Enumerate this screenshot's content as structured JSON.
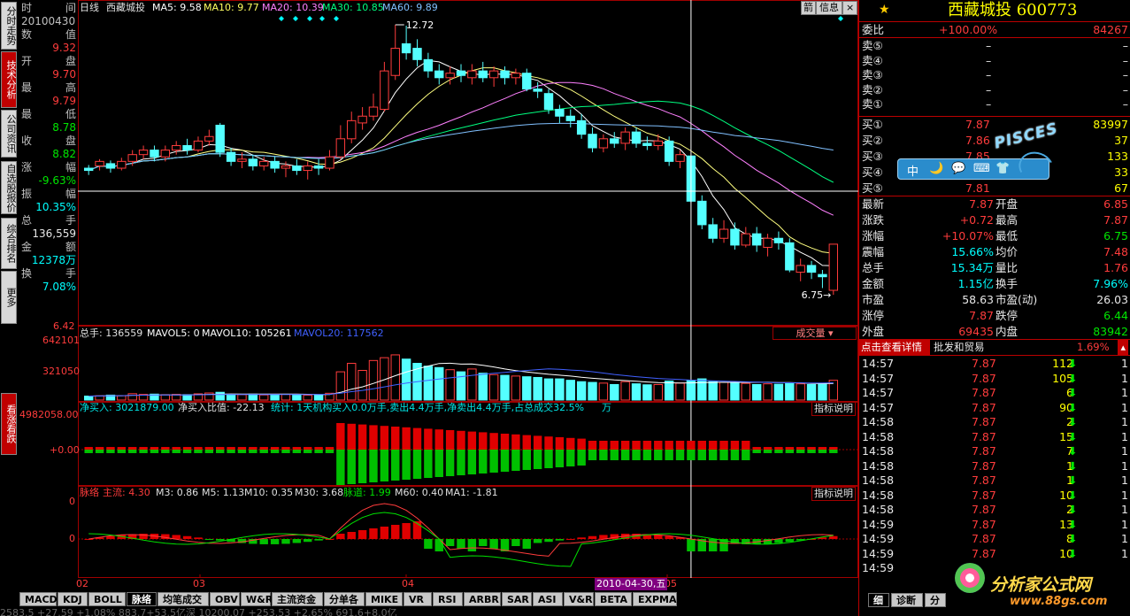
{
  "left_nav": [
    "分时走势",
    "技术分析",
    "公司资讯",
    "自选股报价",
    "综合排名",
    "更多"
  ],
  "left_nav_active": 1,
  "left_nav_lower": "看涨看跌",
  "info": [
    {
      "k": "时",
      "v": "间"
    },
    {
      "k": "20100430",
      "v": ""
    },
    {
      "k": "数",
      "v": "值"
    },
    {
      "k": "",
      "v": "9.32",
      "c": "red"
    },
    {
      "k": "开",
      "v": "盘"
    },
    {
      "k": "",
      "v": "9.70",
      "c": "red"
    },
    {
      "k": "最",
      "v": "高"
    },
    {
      "k": "",
      "v": "9.79",
      "c": "red"
    },
    {
      "k": "最",
      "v": "低"
    },
    {
      "k": "",
      "v": "8.78",
      "c": "grn"
    },
    {
      "k": "收",
      "v": "盘"
    },
    {
      "k": "",
      "v": "8.82",
      "c": "grn"
    },
    {
      "k": "涨",
      "v": "幅"
    },
    {
      "k": "",
      "v": "-9.63%",
      "c": "grn"
    },
    {
      "k": "振",
      "v": "幅"
    },
    {
      "k": "",
      "v": "10.35%",
      "c": "cyn"
    },
    {
      "k": "总",
      "v": "手"
    },
    {
      "k": "",
      "v": "136,559",
      "c": "wht"
    },
    {
      "k": "金",
      "v": "额"
    },
    {
      "k": "",
      "v": "12378万",
      "c": "cyn"
    },
    {
      "k": "换",
      "v": "手"
    },
    {
      "k": "",
      "v": "7.08%",
      "c": "cyn"
    }
  ],
  "main_header": {
    "period": "日线",
    "name": "西藏城投",
    "ma5": "MA5: 9.58",
    "ma10": "MA10: 9.77",
    "ma20": "MA20: 10.39",
    "ma30": "MA30: 10.85",
    "ma60": "MA60: 9.89"
  },
  "main_top_buttons": [
    "箭",
    "信息"
  ],
  "price_high_label": "12.72",
  "price_low_label": "6.75",
  "y_min_label": "6.42",
  "vol_header": {
    "t": "总手: 136559",
    "a": "MAVOL5: 0",
    "b": "MAVOL10: 105261",
    "c": "MAVOL20: 117562"
  },
  "vol_selector": "成交量",
  "vol_y": [
    "642101",
    "321050"
  ],
  "flow_header": {
    "a": "净买入: 3021879.00",
    "b": "净买入比值: -22.13",
    "c": "统计: 1天机构买入0.0万手,卖出4.4万手,净卖出4.4万手,占总成交32.5%",
    "d": "万"
  },
  "flow_y": [
    "4982058.00",
    "+0.00"
  ],
  "pulse_header": {
    "a": "脉络",
    "b": "主流: 4.30",
    "c": "M3: 0.86",
    "d": "M5: 1.13",
    "e": "M10: 0.35",
    "f": "M30: 3.68",
    "g": "脉道: 1.99",
    "h": "M60: 0.40",
    "i": "MA1: -1.81"
  },
  "pulse_y": [
    "0",
    "0"
  ],
  "indicator_btn": "指标说明",
  "x_axis": [
    "02",
    "03",
    "04",
    "05"
  ],
  "cursor_date": "2010-04-30,五",
  "bottom_tabs": [
    "MACD",
    "KDJ",
    "BOLL",
    "脉络",
    "均笔成交",
    "OBV",
    "W&R",
    "主流资金",
    "分单各",
    "MIKE",
    "VR",
    "RSI",
    "ARBR",
    "SAR",
    "ASI",
    "V&R",
    "BETA",
    "EXPMA"
  ],
  "bottom_active": 3,
  "status_partial": "2583.5 +27.59 +1.08%    883.7+53.5亿深  10200.07 +253.53 +2.65%  691.6+8.0亿",
  "right": {
    "title": "西藏城投 600773",
    "webi": {
      "k": "委比",
      "v": "+100.00%",
      "n": "84267"
    },
    "sells": [
      {
        "k": "卖⑤",
        "p": "–",
        "v": ""
      },
      {
        "k": "卖④",
        "p": "–",
        "v": ""
      },
      {
        "k": "卖③",
        "p": "–",
        "v": ""
      },
      {
        "k": "卖②",
        "p": "–",
        "v": ""
      },
      {
        "k": "卖①",
        "p": "–",
        "v": ""
      }
    ],
    "buys": [
      {
        "k": "买①",
        "p": "7.87",
        "v": "83997"
      },
      {
        "k": "买②",
        "p": "7.86",
        "v": "37"
      },
      {
        "k": "买③",
        "p": "7.85",
        "v": "133"
      },
      {
        "k": "买④",
        "p": "7.83",
        "v": "33"
      },
      {
        "k": "买⑤",
        "p": "7.81",
        "v": "67"
      }
    ],
    "stats": [
      {
        "a": "最新",
        "av": "7.87",
        "b": "开盘",
        "bv": "6.85",
        "ac": "red",
        "bc": "red"
      },
      {
        "a": "涨跌",
        "av": "+0.72",
        "b": "最高",
        "bv": "7.87",
        "ac": "red",
        "bc": "red"
      },
      {
        "a": "涨幅",
        "av": "+10.07%",
        "b": "最低",
        "bv": "6.75",
        "ac": "red",
        "bc": "grn"
      },
      {
        "a": "震幅",
        "av": "15.66%",
        "b": "均价",
        "bv": "7.48",
        "ac": "cyn",
        "bc": "red"
      },
      {
        "a": "总手",
        "av": "15.34万",
        "b": "量比",
        "bv": "1.76",
        "ac": "cyn",
        "bc": "red"
      },
      {
        "a": "金额",
        "av": "1.15亿",
        "b": "换手",
        "bv": "7.96%",
        "ac": "cyn",
        "bc": "cyn"
      },
      {
        "a": "市盈",
        "av": "58.63",
        "b": "市盈(动)",
        "bv": "26.03",
        "ac": "wht",
        "bc": "wht"
      },
      {
        "a": "涨停",
        "av": "7.87",
        "b": "跌停",
        "bv": "6.44",
        "ac": "red",
        "bc": "grn"
      },
      {
        "a": "外盘",
        "av": "69435",
        "b": "内盘",
        "bv": "83942",
        "ac": "red",
        "bc": "grn"
      }
    ],
    "detail_tab": "点击查看详情",
    "sector": "批发和贸易",
    "sector_pct": "1.69%",
    "ticks": [
      {
        "t": "14:57",
        "p": "7.87",
        "v": "112",
        "n": "1"
      },
      {
        "t": "14:57",
        "p": "7.87",
        "v": "105",
        "n": "1"
      },
      {
        "t": "14:57",
        "p": "7.87",
        "v": "6",
        "n": "1"
      },
      {
        "t": "14:57",
        "p": "7.87",
        "v": "90",
        "n": "1"
      },
      {
        "t": "14:58",
        "p": "7.87",
        "v": "2",
        "n": "1"
      },
      {
        "t": "14:58",
        "p": "7.87",
        "v": "15",
        "n": "1"
      },
      {
        "t": "14:58",
        "p": "7.87",
        "v": "7",
        "n": "1"
      },
      {
        "t": "14:58",
        "p": "7.87",
        "v": "1",
        "n": "1"
      },
      {
        "t": "14:58",
        "p": "7.87",
        "v": "1",
        "n": "1"
      },
      {
        "t": "14:58",
        "p": "7.87",
        "v": "10",
        "n": "1"
      },
      {
        "t": "14:58",
        "p": "7.87",
        "v": "2",
        "n": "1"
      },
      {
        "t": "14:59",
        "p": "7.87",
        "v": "13",
        "n": "1"
      },
      {
        "t": "14:59",
        "p": "7.87",
        "v": "8",
        "n": "1"
      },
      {
        "t": "14:59",
        "p": "7.87",
        "v": "10",
        "n": "1"
      },
      {
        "t": "14:59",
        "p": "",
        "v": "",
        "n": ""
      }
    ],
    "bottom_tabs": [
      "细",
      "诊断",
      "分"
    ],
    "watermark": "分析家公式网",
    "watermark_url": "www.88gs.com",
    "toolbar_icons": [
      "中",
      "🌙",
      "💬",
      "⌨",
      "👕"
    ],
    "pisces": "PISCES"
  },
  "chart_data": {
    "type": "candlestick",
    "candles": [
      [
        9.55,
        9.5,
        9.62,
        9.4
      ],
      [
        9.6,
        9.7,
        9.75,
        9.5
      ],
      [
        9.65,
        9.55,
        9.72,
        9.45
      ],
      [
        9.55,
        9.7,
        9.78,
        9.5
      ],
      [
        9.7,
        9.85,
        9.95,
        9.6
      ],
      [
        9.85,
        9.95,
        10.05,
        9.75
      ],
      [
        9.95,
        9.8,
        10.05,
        9.7
      ],
      [
        9.8,
        9.95,
        10.05,
        9.7
      ],
      [
        9.95,
        10.05,
        10.15,
        9.85
      ],
      [
        10.05,
        9.95,
        10.2,
        9.85
      ],
      [
        9.95,
        10.15,
        10.25,
        9.9
      ],
      [
        10.15,
        10.25,
        10.4,
        10.05
      ],
      [
        10.5,
        9.9,
        10.55,
        9.8
      ],
      [
        9.9,
        9.7,
        10.0,
        9.6
      ],
      [
        9.7,
        9.75,
        9.9,
        9.55
      ],
      [
        9.75,
        9.6,
        9.85,
        9.5
      ],
      [
        9.6,
        9.7,
        9.8,
        9.5
      ],
      [
        9.7,
        9.55,
        9.8,
        9.45
      ],
      [
        9.55,
        9.6,
        9.7,
        9.35
      ],
      [
        9.6,
        9.5,
        9.75,
        9.4
      ],
      [
        9.5,
        9.6,
        9.7,
        9.3
      ],
      [
        9.6,
        9.55,
        9.75,
        9.4
      ],
      [
        9.55,
        9.8,
        9.95,
        9.5
      ],
      [
        9.8,
        10.2,
        10.5,
        9.75
      ],
      [
        10.2,
        10.6,
        10.8,
        10.1
      ],
      [
        10.55,
        10.7,
        10.9,
        10.4
      ],
      [
        10.7,
        10.9,
        11.2,
        10.6
      ],
      [
        10.85,
        11.7,
        11.9,
        10.8
      ],
      [
        11.6,
        12.2,
        12.72,
        11.5
      ],
      [
        12.3,
        12.1,
        12.7,
        11.95
      ],
      [
        12.2,
        11.95,
        12.4,
        11.8
      ],
      [
        11.95,
        11.7,
        12.1,
        11.55
      ],
      [
        11.7,
        11.55,
        11.85,
        11.4
      ],
      [
        11.55,
        11.65,
        11.8,
        11.4
      ],
      [
        11.7,
        11.6,
        11.85,
        11.45
      ],
      [
        11.55,
        11.7,
        11.85,
        11.4
      ],
      [
        11.7,
        11.55,
        11.9,
        11.45
      ],
      [
        11.55,
        11.7,
        11.8,
        11.35
      ],
      [
        11.7,
        11.55,
        11.8,
        11.4
      ],
      [
        11.55,
        11.65,
        11.75,
        11.4
      ],
      [
        11.65,
        11.3,
        11.75,
        11.25
      ],
      [
        11.3,
        11.25,
        11.45,
        11.1
      ],
      [
        11.2,
        10.85,
        11.3,
        10.75
      ],
      [
        10.85,
        10.7,
        10.95,
        10.55
      ],
      [
        10.7,
        10.6,
        10.85,
        10.45
      ],
      [
        10.6,
        10.3,
        10.75,
        10.2
      ],
      [
        10.3,
        10.0,
        10.45,
        9.9
      ],
      [
        10.0,
        10.2,
        10.3,
        9.9
      ],
      [
        10.2,
        10.1,
        10.35,
        10.0
      ],
      [
        10.1,
        10.35,
        10.45,
        9.95
      ],
      [
        10.35,
        10.1,
        10.45,
        10.0
      ],
      [
        10.1,
        10.05,
        10.25,
        9.95
      ],
      [
        10.05,
        10.15,
        10.3,
        9.95
      ],
      [
        10.15,
        9.7,
        10.25,
        9.6
      ],
      [
        9.7,
        9.85,
        9.95,
        9.55
      ],
      [
        9.82,
        8.82,
        9.79,
        8.78
      ],
      [
        8.82,
        8.3,
        8.95,
        8.2
      ],
      [
        8.3,
        8.0,
        8.45,
        7.9
      ],
      [
        8.0,
        8.2,
        8.4,
        7.9
      ],
      [
        8.2,
        7.85,
        8.35,
        7.75
      ],
      [
        7.85,
        8.1,
        8.25,
        7.8
      ],
      [
        8.1,
        7.85,
        8.25,
        7.7
      ],
      [
        7.8,
        8.0,
        8.1,
        7.6
      ],
      [
        8.0,
        7.9,
        8.15,
        7.75
      ],
      [
        7.9,
        7.3,
        8.0,
        7.25
      ],
      [
        7.25,
        7.4,
        7.55,
        7.05
      ],
      [
        7.4,
        7.25,
        7.5,
        7.1
      ],
      [
        7.2,
        7.15,
        7.3,
        6.9
      ],
      [
        6.85,
        7.87,
        7.87,
        6.75
      ]
    ],
    "y_high": 12.72,
    "y_low": 6.42
  }
}
